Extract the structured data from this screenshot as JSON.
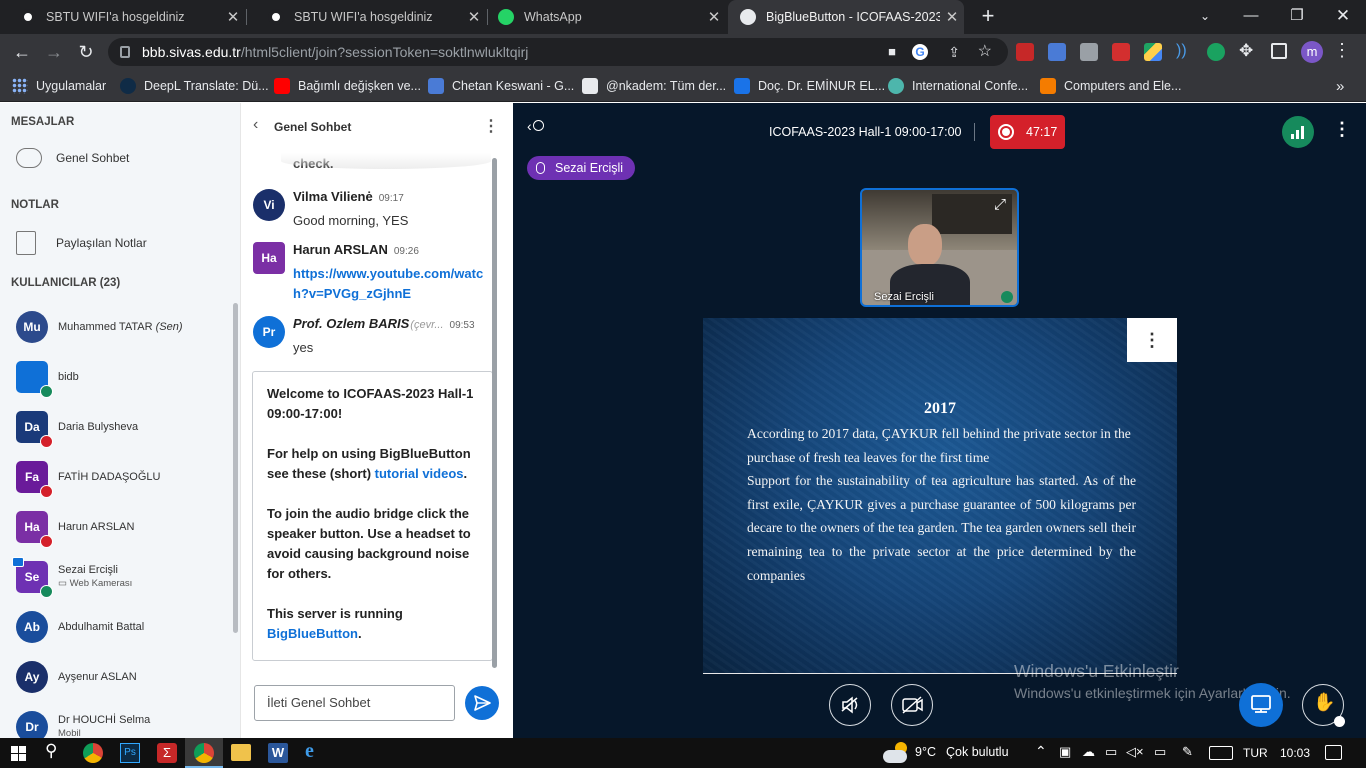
{
  "browser": {
    "tabs": [
      {
        "title": "SBTU WIFI'a hosgeldiniz",
        "favicon": "wifi-icon"
      },
      {
        "title": "SBTU WIFI'a hosgeldiniz",
        "favicon": "wifi-icon"
      },
      {
        "title": "WhatsApp",
        "favicon": "whatsapp-icon"
      },
      {
        "title": "BigBlueButton - ICOFAAS-2023 H",
        "favicon": "bigbluebutton-icon",
        "active": true
      }
    ],
    "url_host": "bbb.sivas.edu.tr",
    "url_path": "/html5client/join?sessionToken=soktlnwlukltqirj",
    "profile_initial": "m",
    "bookmarks": [
      "Uygulamalar",
      "DeepL Translate: Dü...",
      "Bağımlı değişken ve...",
      "Chetan Keswani - G...",
      "@nkadem: Tüm der...",
      "Doç. Dr. EMİNUR EL...",
      "International Confe...",
      "Computers and Ele..."
    ]
  },
  "sidebar": {
    "messages_header": "MESAJLAR",
    "public_chat_label": "Genel Sohbet",
    "notes_header": "NOTLAR",
    "shared_notes_label": "Paylaşılan Notlar",
    "users_header": "KULLANICILAR (23)",
    "users": [
      {
        "initials": "Mu",
        "name": "Muhammed TATAR",
        "suffix": "(Sen)",
        "color": "#2c4a8c"
      },
      {
        "initials": "",
        "name": "bidb",
        "color": "#0f70d7"
      },
      {
        "initials": "Da",
        "name": "Daria Bulysheva",
        "color": "#1a3a7a"
      },
      {
        "initials": "Fa",
        "name": "FATİH DADAŞOĞLU",
        "color": "#6a1b9a"
      },
      {
        "initials": "Ha",
        "name": "Harun ARSLAN",
        "color": "#7b2fa5"
      },
      {
        "initials": "Se",
        "name": "Sezai Ercişli",
        "sub": "Web Kamerası",
        "color": "#6e31b3"
      },
      {
        "initials": "Ab",
        "name": "Abdulhamit Battal",
        "color": "#1a4d9c"
      },
      {
        "initials": "Ay",
        "name": "Ayşenur ASLAN",
        "color": "#1a2f6a"
      },
      {
        "initials": "Dr",
        "name": "Dr HOUCHİ Selma",
        "sub": "Mobil",
        "color": "#1a4d9c"
      }
    ]
  },
  "chat": {
    "title": "Genel Sohbet",
    "partial_text": "check.",
    "messages": [
      {
        "initials": "Vi",
        "name": "Vilma Vilienė",
        "time": "09:17",
        "text": "Good morning, YES",
        "color": "#1a2f6a"
      },
      {
        "initials": "Ha",
        "name": "Harun ARSLAN",
        "time": "09:26",
        "link": "https://www.youtube.com/watch?v=PVGg_zGjhnE",
        "link_line1": "https://www.youtube.com/watc",
        "link_line2": "h?v=PVGg_zGjhnE",
        "color": "#7b2fa5"
      },
      {
        "initials": "Pr",
        "name": "Prof. Ozlem BARIS",
        "status": "(çevr...",
        "time": "09:53",
        "text": "yes",
        "color": "#0f70d7"
      }
    ],
    "welcome": {
      "p1_prefix": "Welcome to ",
      "p1_strong": "ICOFAAS-2023 Hall-1 09:00-17:00!",
      "p2_prefix": "For help on using BigBlueButton see these (short) ",
      "p2_link": "tutorial videos",
      "p2_suffix": ".",
      "p3": "To join the audio bridge click the speaker button. Use a headset to avoid causing background noise for others.",
      "p4_prefix": "This server is running ",
      "p4_link": "BigBlueButton",
      "p4_suffix": "."
    },
    "input_placeholder": "İleti Genel Sohbet"
  },
  "meeting": {
    "title": "ICOFAAS-2023 Hall-1 09:00-17:00",
    "recording_time": "47:17",
    "talking_user": "Sezai Ercişli",
    "webcam_user": "Sezai Ercişli",
    "slide": {
      "title": "2017",
      "paragraph1": "According to 2017 data, ÇAYKUR fell behind the private sector in the purchase of fresh tea leaves for the first time",
      "paragraph2": "Support for the sustainability of tea agriculture has started. As of the first exile, ÇAYKUR gives a purchase guarantee of 500 kilograms per decare to the owners of the tea garden. The tea garden owners sell their remaining tea to the private sector at the price determined by the companies"
    },
    "watermark_title": "Windows'u Etkinleştir",
    "watermark_sub": "Windows'u etkinleştirmek için Ayarlar'a gidin."
  },
  "taskbar": {
    "weather_temp": "9°C",
    "weather_desc": "Çok bulutlu",
    "language": "TUR",
    "time": "10:03"
  },
  "colors": {
    "bbb_blue": "#0f70d7",
    "recording_red": "#d4202a",
    "talker_purple": "#6e31b3",
    "slide_blue": "#16467a"
  }
}
